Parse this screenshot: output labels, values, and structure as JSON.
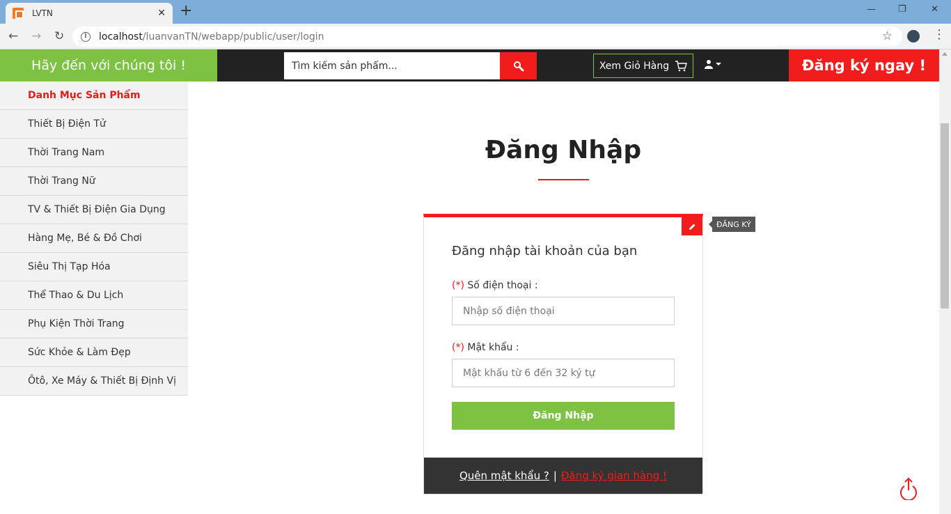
{
  "browser": {
    "tab_title": "LVTN",
    "tab_close": "✕",
    "new_tab": "+",
    "url_host": "localhost",
    "url_path": "/luanvanTN/webapp/public/user/login",
    "win_min": "—",
    "win_restore": "❐",
    "win_close": "✕"
  },
  "header": {
    "welcome": "Hãy đến với chúng tôi !",
    "search_placeholder": "Tìm kiếm sản phẩm...",
    "cart_label": "Xem Giỏ Hàng",
    "register_now": "Đăng ký ngay !"
  },
  "sidebar": {
    "heading": "Danh Mục Sản Phẩm",
    "items": [
      "Thiết Bị Điện Tử",
      "Thời Trang Nam",
      "Thời Trang Nữ",
      "TV & Thiết Bị Điện Gia Dụng",
      "Hàng Mẹ, Bé & Đồ Chơi",
      "Siêu Thị Tạp Hóa",
      "Thể Thao & Du Lịch",
      "Phụ Kiện Thời Trang",
      "Sức Khỏe & Làm Đẹp",
      "Ôtô, Xe Máy & Thiết Bị Định Vị"
    ]
  },
  "main": {
    "title": "Đăng Nhập",
    "register_tooltip": "ĐĂNG KÝ",
    "card_heading": "Đăng nhập tài khoản của bạn",
    "required_mark": "(*)",
    "phone_label": "Số điện thoại :",
    "phone_placeholder": "Nhập số điện thoại",
    "password_label": "Mật khẩu :",
    "password_placeholder": "Mật khẩu từ 6 đến 32 ký tự",
    "login_button": "Đăng Nhập",
    "forgot_password": "Quên mật khẩu ?",
    "separator": "|",
    "register_shop": "Đăng ký gian hàng !"
  },
  "colors": {
    "accent_red": "#f11d1d",
    "accent_green": "#7dc242",
    "dark": "#222222"
  }
}
